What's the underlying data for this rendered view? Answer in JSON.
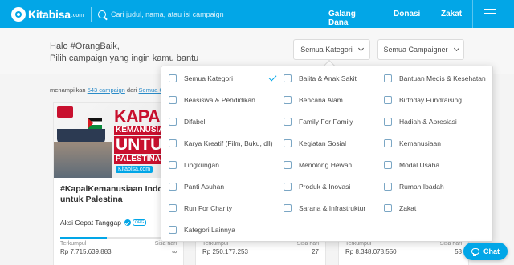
{
  "header": {
    "logo_text": "Kitabisa",
    "logo_suffix": ".com",
    "search_placeholder": "Cari judul, nama, atau isi campaign",
    "nav": [
      "Galang Dana",
      "Donasi",
      "Zakat"
    ],
    "brand_color": "#02a6e7"
  },
  "greeting": {
    "line1": "Halo #OrangBaik,",
    "line2": "Pilih campaign yang ingin kamu bantu"
  },
  "filters": {
    "category": "Semua Kategori",
    "campaigner": "Semua Campaigner"
  },
  "listing": {
    "count_prefix": "menampilkan",
    "count_link": "543 campaign",
    "count_from": "dari",
    "count_source": "Semua C"
  },
  "categories": [
    [
      "Semua Kategori",
      "Balita & Anak Sakit",
      "Bantuan Medis & Kesehatan"
    ],
    [
      "Beasiswa & Pendidikan",
      "Bencana Alam",
      "Birthday Fundraising"
    ],
    [
      "Difabel",
      "Family For Family",
      "Hadiah & Apresiasi"
    ],
    [
      "Karya Kreatif (Film, Buku, dll)",
      "Kegiatan Sosial",
      "Kemanusiaan"
    ],
    [
      "Lingkungan",
      "Menolong Hewan",
      "Modal Usaha"
    ],
    [
      "Panti Asuhan",
      "Produk & Inovasi",
      "Rumah Ibadah"
    ],
    [
      "Run For Charity",
      "Sarana & Infrastruktur",
      "Zakat"
    ],
    [
      "Kategori Lainnya"
    ]
  ],
  "selected_category": "Semua Kategori",
  "campaigns": [
    {
      "poster_line1": "KAPAL",
      "poster_line2": "KEMANUSIAA",
      "poster_line3": "UNTUK",
      "poster_line4": "PALESTINA",
      "poster_logo": "Kitabisa.com",
      "title_line1": "#KapalKemanusiaan Indonesia",
      "title_line2": "untuk Palestina",
      "organizer": "Aksi Cepat Tanggap",
      "organizer_tag": "ORG",
      "progress": 0.4,
      "collected_label": "Terkumpul",
      "collected": "Rp 7.715.639.883",
      "remaining_label": "Sisa hari",
      "remaining": "∞"
    },
    {
      "collected_label": "Terkumpul",
      "collected": "Rp 250.177.253",
      "remaining_label": "Sisa hari",
      "remaining": "27",
      "progress": 0.5
    },
    {
      "collected_label": "Terkumpul",
      "collected": "Rp 8.348.078.550",
      "remaining_label": "Sisa hari",
      "remaining": "58",
      "progress": 0.45
    }
  ],
  "chat": {
    "label": "Chat"
  }
}
